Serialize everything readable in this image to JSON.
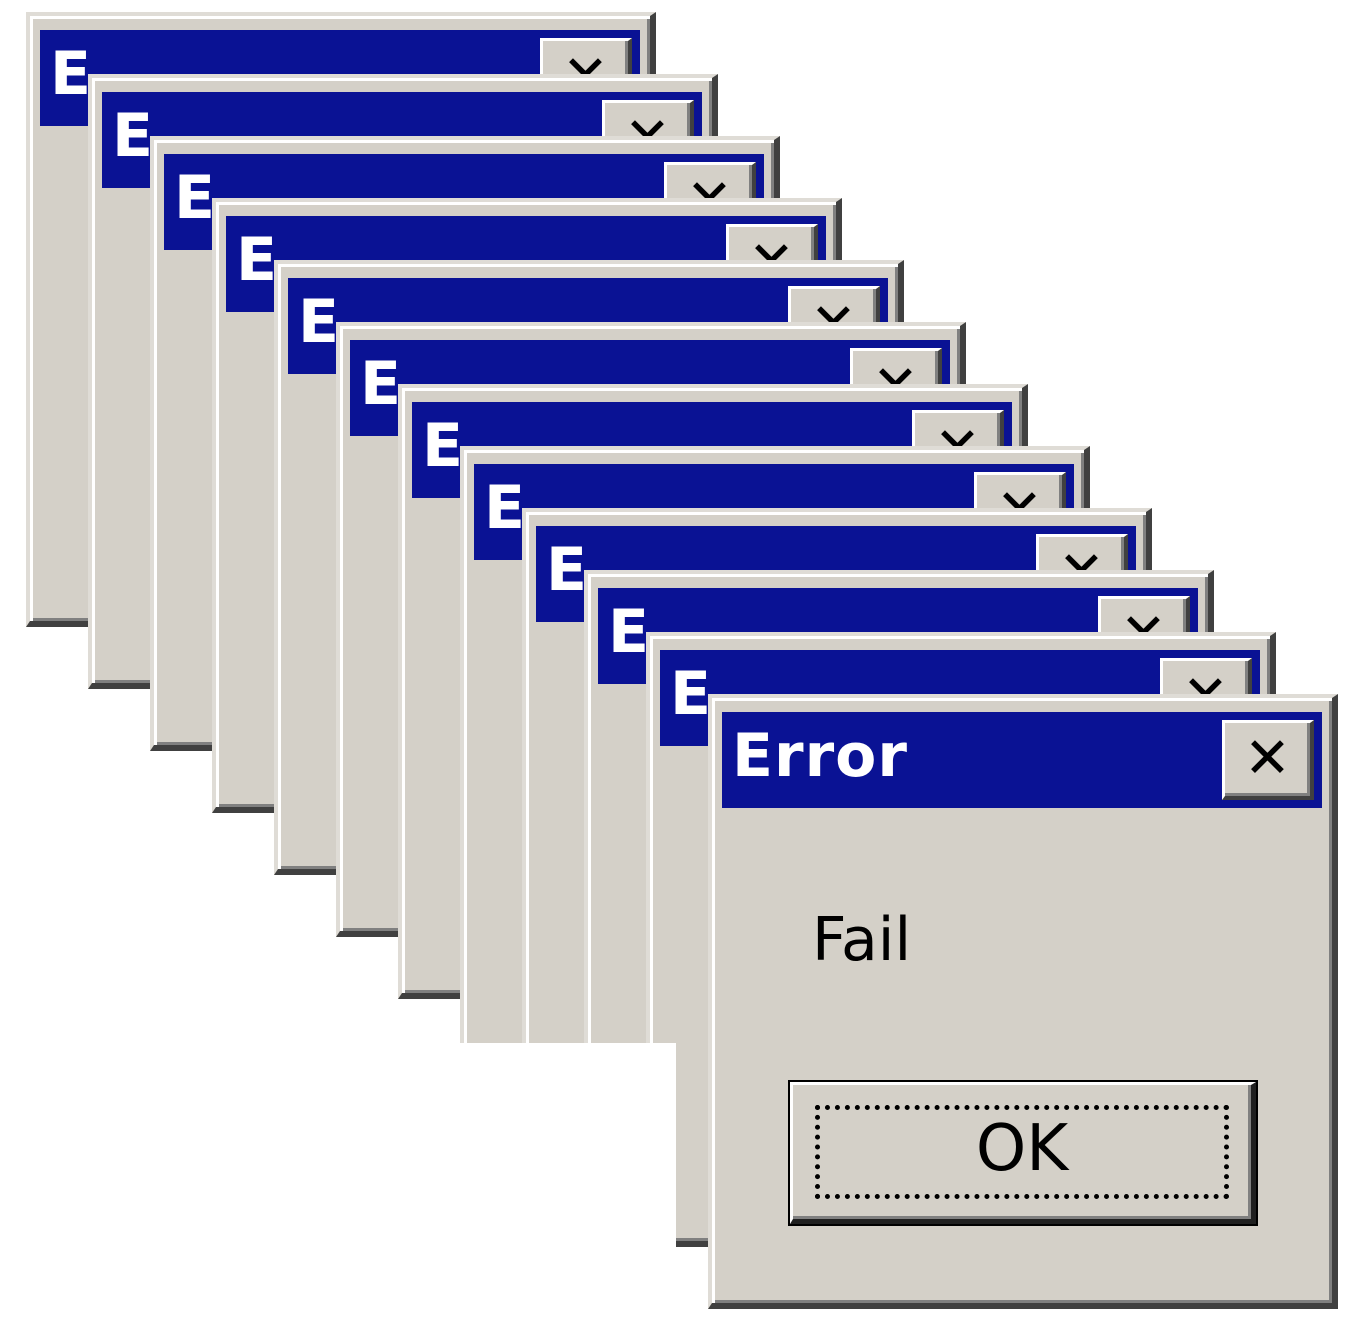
{
  "dialog": {
    "title": "Error",
    "partial_title": "E",
    "close_glyph": "✕",
    "message": "Fail",
    "ok_label": "OK",
    "stack_count": 12
  },
  "colors": {
    "titlebar": "#0a1294",
    "face": "#d4d0c8",
    "background": "#ffffff"
  },
  "icons": {
    "close": "close-icon"
  }
}
